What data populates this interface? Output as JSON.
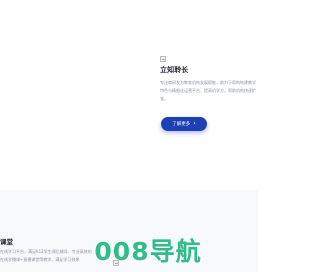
{
  "feature_card": {
    "title": "立知聆长",
    "description": "专注商研发为教育机构发展赋能，助力于帮构构建教学特色与精细化运营平台，提高机学方，帮助机构快速扩张。",
    "button_label": "了解更多",
    "button_icon": "chevron-right-icon"
  },
  "left_card": {
    "title": "课堂",
    "description": "在线学习平台，满足K12学生课后辅导、专业高效的在线学播课+直播课堂等教学，满足学习效果"
  },
  "watermark": {
    "text": "008导航"
  },
  "colors": {
    "accent": "#1e3fb5",
    "watermark": "#16b47a",
    "title": "#222630",
    "body_text": "#8c929e"
  }
}
